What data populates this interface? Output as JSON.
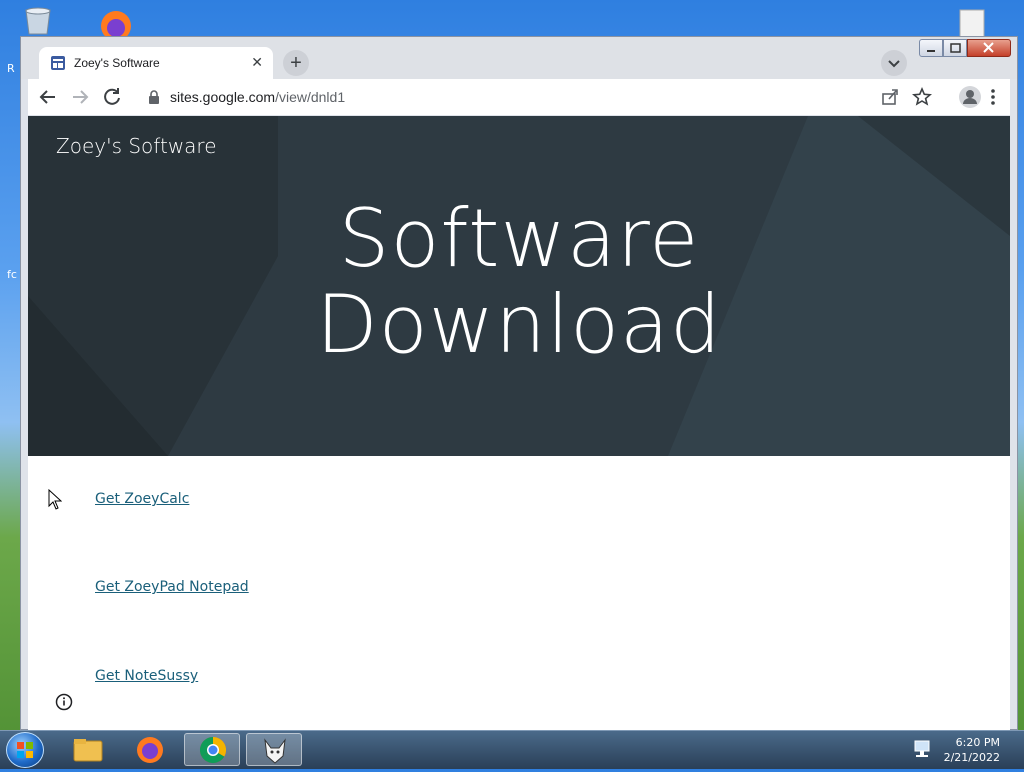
{
  "browser": {
    "tab_title": "Zoey's Software",
    "url_host": "sites.google.com",
    "url_path": "/view/dnld1"
  },
  "page": {
    "site_name": "Zoey's Software",
    "hero_line1": "Software",
    "hero_line2": "Download",
    "links": [
      "Get ZoeyCalc",
      "Get ZoeyPad Notepad",
      "Get NoteSussy"
    ]
  },
  "desktop": {
    "edge_text_1": "R",
    "edge_text_2": "fc"
  },
  "taskbar": {
    "time": "6:20 PM",
    "date": "2/21/2022"
  },
  "colors": {
    "hero_bg": "#2e3a42",
    "link": "#1a5f7a",
    "tabstrip": "#dee1e6"
  },
  "icons": {
    "tab_favicon": "sites-page-icon",
    "lock": "lock-icon",
    "info": "info-icon"
  }
}
